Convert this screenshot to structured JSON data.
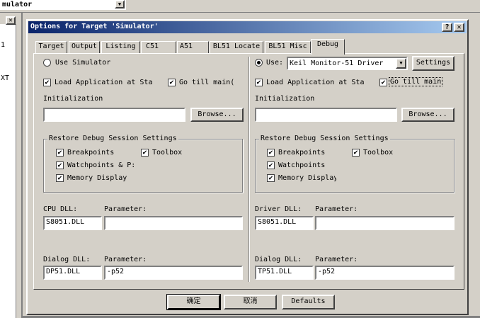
{
  "bg_window": {
    "combo_text": "mulator",
    "side_labels": [
      "1",
      "XT"
    ]
  },
  "dialog": {
    "title": "Options for Target 'Simulator'",
    "tabs": [
      "Target",
      "Output",
      "Listing",
      "C51",
      "A51",
      "BL51 Locate",
      "BL51 Misc",
      "Debug"
    ],
    "active_tab": "Debug",
    "left": {
      "use_simulator": "Use Simulator",
      "load_app": "Load Application at Sta",
      "go_till_main": "Go  till main(",
      "initialization": "Initialization",
      "init_value": "",
      "browse": "Browse...",
      "restore_title": "Restore Debug Session Settings",
      "breakpoints": "Breakpoints",
      "toolbox": "Toolbox",
      "watchpoints": "Watchpoints & P:",
      "memory_display": "Memory Display",
      "cpu_dll_label": "CPU DLL:",
      "cpu_param_label": "Parameter:",
      "cpu_dll_value": "S8051.DLL",
      "cpu_param_value": "",
      "dialog_dll_label": "Dialog DLL:",
      "dialog_param_label": "Parameter:",
      "dialog_dll_value": "DP51.DLL",
      "dialog_param_value": "-p52"
    },
    "right": {
      "use_label": "Use:",
      "driver_select": "Keil Monitor-51 Driver",
      "settings": "Settings",
      "load_app": "Load Application at Sta",
      "go_till_main": "Go  till main",
      "initialization": "Initialization",
      "init_value": "",
      "browse": "Browse...",
      "restore_title": "Restore Debug Session Settings",
      "breakpoints": "Breakpoints",
      "toolbox": "Toolbox",
      "watchpoints": "Watchpoints",
      "memory_display": "Memory Display",
      "driver_dll_label": "Driver DLL:",
      "driver_param_label": "Parameter:",
      "driver_dll_value": "S8051.DLL",
      "driver_param_value": "",
      "dialog_dll_label": "Dialog DLL:",
      "dialog_param_label": "Parameter:",
      "dialog_dll_value": "TP51.DLL",
      "dialog_param_value": "-p52"
    },
    "buttons": {
      "ok": "确定",
      "cancel": "取消",
      "defaults": "Defaults"
    }
  },
  "colors": {
    "titlebar_start": "#0a246a",
    "titlebar_end": "#a6caf0",
    "face": "#d4d0c8"
  }
}
